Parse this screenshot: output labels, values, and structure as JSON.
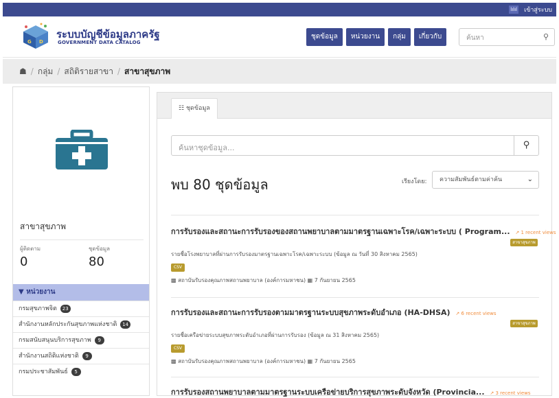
{
  "topbar": {
    "icon_label": "lılıl",
    "login": "เข้าสู่ระบบ"
  },
  "header": {
    "brand_th": "ระบบบัญชีข้อมูลภาครัฐ",
    "brand_en": "GOVERNMENT DATA CATALOG",
    "nav": [
      "ชุดข้อมูล",
      "หน่วยงาน",
      "กลุ่ม",
      "เกี่ยวกับ"
    ],
    "search_placeholder": "ค้นหา",
    "search_icon": "search-icon"
  },
  "breadcrumb": {
    "home_icon": "home-icon",
    "items": [
      "กลุ่ม",
      "สถิติรายสาขา"
    ],
    "current": "สาขาสุขภาพ"
  },
  "sidebar": {
    "org_title": "สาขาสุขภาพ",
    "stats": [
      {
        "label": "ผู้ติดตาม",
        "value": "0"
      },
      {
        "label": "ชุดข้อมูล",
        "value": "80"
      }
    ],
    "agencies_header": "หน่วยงาน",
    "agencies": [
      {
        "name": "กรมสุขภาพจิต",
        "count": "23"
      },
      {
        "name": "สำนักงานหลักประกันสุขภาพแห่งชาติ",
        "count": "14"
      },
      {
        "name": "กรมสนับสนุนบริการสุขภาพ",
        "count": "9"
      },
      {
        "name": "สำนักงานสถิติแห่งชาติ",
        "count": "9"
      },
      {
        "name": "กรมประชาสัมพันธ์",
        "count": "5"
      }
    ]
  },
  "main": {
    "tab_label": "ชุดข้อมูล",
    "search_placeholder": "ค้นหาชุดข้อมูล...",
    "found_text": "พบ 80 ชุดข้อมูล",
    "sort_label": "เรียงโดย:",
    "sort_value": "ความสัมพันธ์ตามค่าค้น",
    "datasets": [
      {
        "title": "การรับรองและสถานะการรับรองของสถานพยาบาลตามมาตรฐานเฉพาะโรค/เฉพาะระบบ ( Program...",
        "views": "1 recent views",
        "tag": "สาขาสุขภาพ",
        "description": "รายชื่อโรงพยาบาลที่ผ่านการรับรองมาตรฐานเฉพาะโรค/เฉพาะระบบ (ข้อมูล ณ วันที่ 30 สิงหาคม 2565)",
        "format": "CSV",
        "org": "สถาบันรับรองคุณภาพสถานพยาบาล (องค์การมหาชน)",
        "date": "7 กันยายน 2565"
      },
      {
        "title": "การรับรองและสถานะการรับรองตามมาตรฐานระบบสุขภาพระดับอำเภอ (HA-DHSA)",
        "views": "6 recent views",
        "tag": "สาขาสุขภาพ",
        "description": "รายชื่อเครือข่ายระบบสุขภาพระดับอำเภอที่ผ่านการรับรอง (ข้อมูล ณ 31 สิงหาคม 2565)",
        "format": "CSV",
        "org": "สถาบันรับรองคุณภาพสถานพยาบาล (องค์การมหาชน)",
        "date": "7 กันยายน 2565"
      },
      {
        "title": "การรับรองสถานพยาบาลตามมาตรฐานระบบเครือข่ายบริการสุขภาพระดับจังหวัด (Provincia...",
        "views": "3 recent views"
      }
    ]
  },
  "colors": {
    "primary": "#3c4a8f",
    "tag": "#b89b2e",
    "views": "#f08c3c",
    "agencies_header_bg": "#b3bde8"
  }
}
